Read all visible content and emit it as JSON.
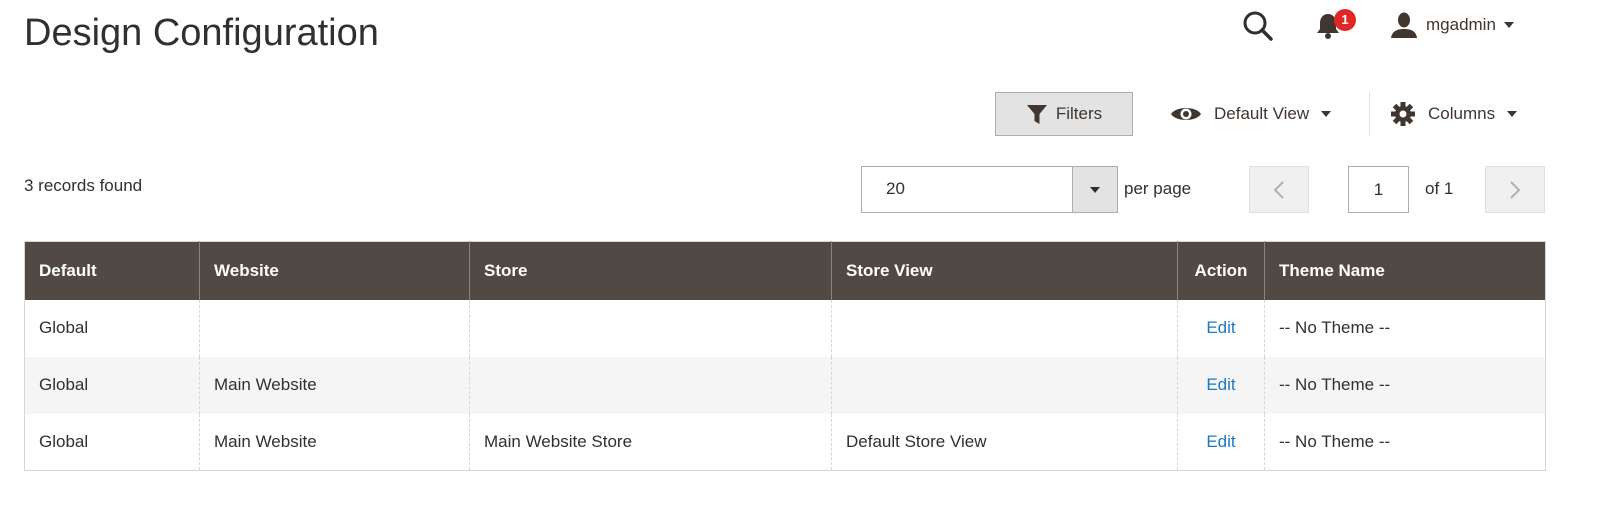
{
  "header": {
    "title": "Design Configuration",
    "notification_count": "1",
    "username": "mgadmin"
  },
  "toolbar": {
    "filters_label": "Filters",
    "view_label": "Default View",
    "columns_label": "Columns"
  },
  "grid": {
    "records_found": "3 records found",
    "per_page_value": "20",
    "per_page_label": "per page",
    "current_page": "1",
    "of_pages": "of 1",
    "columns": [
      "Default",
      "Website",
      "Store",
      "Store View",
      "Action",
      "Theme Name"
    ],
    "rows": [
      [
        "Global",
        "",
        "",
        "",
        "Edit",
        "-- No Theme --"
      ],
      [
        "Global",
        "Main Website",
        "",
        "",
        "Edit",
        "-- No Theme --"
      ],
      [
        "Global",
        "Main Website",
        "Main Website Store",
        "Default Store View",
        "Edit",
        "-- No Theme --"
      ]
    ]
  },
  "colors": {
    "header_bg": "#514943",
    "link": "#1979c3",
    "badge": "#e22626"
  }
}
